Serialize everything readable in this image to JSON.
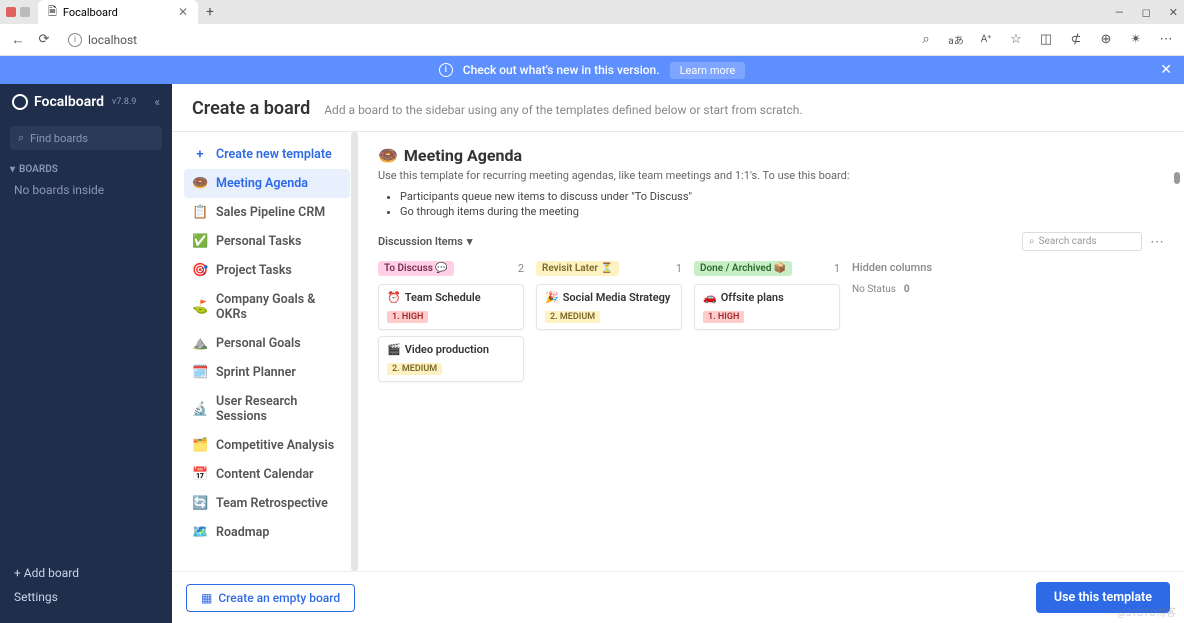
{
  "browser": {
    "tab_title": "Focalboard",
    "address": "localhost"
  },
  "banner": {
    "text": "Check out what's new in this version.",
    "cta": "Learn more"
  },
  "sidebar": {
    "brand": "Focalboard",
    "version": "v7.8.9",
    "search_placeholder": "Find boards",
    "section": "BOARDS",
    "empty": "No boards inside",
    "add_board": "+ Add board",
    "settings": "Settings"
  },
  "header": {
    "title": "Create a board",
    "subtitle": "Add a board to the sidebar using any of the templates defined below or start from scratch."
  },
  "templates": {
    "create": "Create new template",
    "items": [
      {
        "icon": "🍩",
        "label": "Meeting Agenda"
      },
      {
        "icon": "📋",
        "label": "Sales Pipeline CRM"
      },
      {
        "icon": "✅",
        "label": "Personal Tasks"
      },
      {
        "icon": "🎯",
        "label": "Project Tasks"
      },
      {
        "icon": "⛳",
        "label": "Company Goals & OKRs"
      },
      {
        "icon": "⛰️",
        "label": "Personal Goals"
      },
      {
        "icon": "🗓️",
        "label": "Sprint Planner"
      },
      {
        "icon": "🔬",
        "label": "User Research Sessions"
      },
      {
        "icon": "🗂️",
        "label": "Competitive Analysis"
      },
      {
        "icon": "📅",
        "label": "Content Calendar"
      },
      {
        "icon": "🔄",
        "label": "Team Retrospective"
      },
      {
        "icon": "🗺️",
        "label": "Roadmap"
      }
    ]
  },
  "preview": {
    "icon": "🍩",
    "title": "Meeting Agenda",
    "description": "Use this template for recurring meeting agendas, like team meetings and 1:1's. To use this board:",
    "bullets": [
      "Participants queue new items to discuss under \"To Discuss\"",
      "Go through items during the meeting"
    ],
    "view": "Discussion Items",
    "search_placeholder": "Search cards",
    "columns": [
      {
        "label": "To Discuss 💬",
        "class": "pink",
        "count": "2",
        "cards": [
          {
            "icon": "⏰",
            "title": "Team Schedule",
            "tag": "1. HIGH",
            "tag_class": "tag-high"
          },
          {
            "icon": "🎬",
            "title": "Video production",
            "tag": "2. MEDIUM",
            "tag_class": "tag-med"
          }
        ]
      },
      {
        "label": "Revisit Later ⏳",
        "class": "yellow",
        "count": "1",
        "cards": [
          {
            "icon": "🎉",
            "title": "Social Media Strategy",
            "tag": "2. MEDIUM",
            "tag_class": "tag-med"
          }
        ]
      },
      {
        "label": "Done / Archived 📦",
        "class": "green",
        "count": "1",
        "cards": [
          {
            "icon": "🚗",
            "title": "Offsite plans",
            "tag": "1. HIGH",
            "tag_class": "tag-high"
          }
        ]
      }
    ],
    "hidden_label": "Hidden columns",
    "no_status_label": "No Status",
    "no_status_count": "0"
  },
  "footer": {
    "empty_board": "Create an empty board",
    "use_template": "Use this template"
  },
  "watermark": "@51CTO博客"
}
